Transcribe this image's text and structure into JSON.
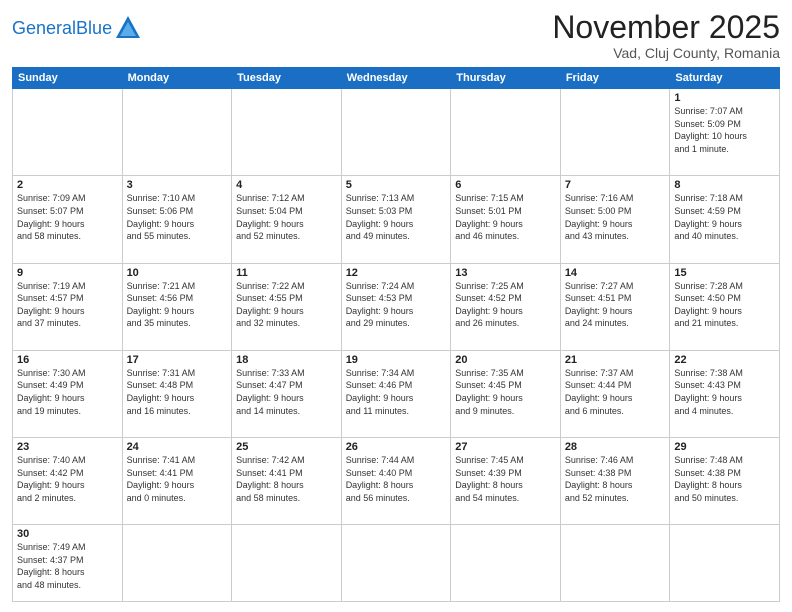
{
  "header": {
    "logo_general": "General",
    "logo_blue": "Blue",
    "month": "November 2025",
    "location": "Vad, Cluj County, Romania"
  },
  "weekdays": [
    "Sunday",
    "Monday",
    "Tuesday",
    "Wednesday",
    "Thursday",
    "Friday",
    "Saturday"
  ],
  "weeks": [
    [
      {
        "day": "",
        "info": ""
      },
      {
        "day": "",
        "info": ""
      },
      {
        "day": "",
        "info": ""
      },
      {
        "day": "",
        "info": ""
      },
      {
        "day": "",
        "info": ""
      },
      {
        "day": "",
        "info": ""
      },
      {
        "day": "1",
        "info": "Sunrise: 7:07 AM\nSunset: 5:09 PM\nDaylight: 10 hours\nand 1 minute."
      }
    ],
    [
      {
        "day": "2",
        "info": "Sunrise: 7:09 AM\nSunset: 5:07 PM\nDaylight: 9 hours\nand 58 minutes."
      },
      {
        "day": "3",
        "info": "Sunrise: 7:10 AM\nSunset: 5:06 PM\nDaylight: 9 hours\nand 55 minutes."
      },
      {
        "day": "4",
        "info": "Sunrise: 7:12 AM\nSunset: 5:04 PM\nDaylight: 9 hours\nand 52 minutes."
      },
      {
        "day": "5",
        "info": "Sunrise: 7:13 AM\nSunset: 5:03 PM\nDaylight: 9 hours\nand 49 minutes."
      },
      {
        "day": "6",
        "info": "Sunrise: 7:15 AM\nSunset: 5:01 PM\nDaylight: 9 hours\nand 46 minutes."
      },
      {
        "day": "7",
        "info": "Sunrise: 7:16 AM\nSunset: 5:00 PM\nDaylight: 9 hours\nand 43 minutes."
      },
      {
        "day": "8",
        "info": "Sunrise: 7:18 AM\nSunset: 4:59 PM\nDaylight: 9 hours\nand 40 minutes."
      }
    ],
    [
      {
        "day": "9",
        "info": "Sunrise: 7:19 AM\nSunset: 4:57 PM\nDaylight: 9 hours\nand 37 minutes."
      },
      {
        "day": "10",
        "info": "Sunrise: 7:21 AM\nSunset: 4:56 PM\nDaylight: 9 hours\nand 35 minutes."
      },
      {
        "day": "11",
        "info": "Sunrise: 7:22 AM\nSunset: 4:55 PM\nDaylight: 9 hours\nand 32 minutes."
      },
      {
        "day": "12",
        "info": "Sunrise: 7:24 AM\nSunset: 4:53 PM\nDaylight: 9 hours\nand 29 minutes."
      },
      {
        "day": "13",
        "info": "Sunrise: 7:25 AM\nSunset: 4:52 PM\nDaylight: 9 hours\nand 26 minutes."
      },
      {
        "day": "14",
        "info": "Sunrise: 7:27 AM\nSunset: 4:51 PM\nDaylight: 9 hours\nand 24 minutes."
      },
      {
        "day": "15",
        "info": "Sunrise: 7:28 AM\nSunset: 4:50 PM\nDaylight: 9 hours\nand 21 minutes."
      }
    ],
    [
      {
        "day": "16",
        "info": "Sunrise: 7:30 AM\nSunset: 4:49 PM\nDaylight: 9 hours\nand 19 minutes."
      },
      {
        "day": "17",
        "info": "Sunrise: 7:31 AM\nSunset: 4:48 PM\nDaylight: 9 hours\nand 16 minutes."
      },
      {
        "day": "18",
        "info": "Sunrise: 7:33 AM\nSunset: 4:47 PM\nDaylight: 9 hours\nand 14 minutes."
      },
      {
        "day": "19",
        "info": "Sunrise: 7:34 AM\nSunset: 4:46 PM\nDaylight: 9 hours\nand 11 minutes."
      },
      {
        "day": "20",
        "info": "Sunrise: 7:35 AM\nSunset: 4:45 PM\nDaylight: 9 hours\nand 9 minutes."
      },
      {
        "day": "21",
        "info": "Sunrise: 7:37 AM\nSunset: 4:44 PM\nDaylight: 9 hours\nand 6 minutes."
      },
      {
        "day": "22",
        "info": "Sunrise: 7:38 AM\nSunset: 4:43 PM\nDaylight: 9 hours\nand 4 minutes."
      }
    ],
    [
      {
        "day": "23",
        "info": "Sunrise: 7:40 AM\nSunset: 4:42 PM\nDaylight: 9 hours\nand 2 minutes."
      },
      {
        "day": "24",
        "info": "Sunrise: 7:41 AM\nSunset: 4:41 PM\nDaylight: 9 hours\nand 0 minutes."
      },
      {
        "day": "25",
        "info": "Sunrise: 7:42 AM\nSunset: 4:41 PM\nDaylight: 8 hours\nand 58 minutes."
      },
      {
        "day": "26",
        "info": "Sunrise: 7:44 AM\nSunset: 4:40 PM\nDaylight: 8 hours\nand 56 minutes."
      },
      {
        "day": "27",
        "info": "Sunrise: 7:45 AM\nSunset: 4:39 PM\nDaylight: 8 hours\nand 54 minutes."
      },
      {
        "day": "28",
        "info": "Sunrise: 7:46 AM\nSunset: 4:38 PM\nDaylight: 8 hours\nand 52 minutes."
      },
      {
        "day": "29",
        "info": "Sunrise: 7:48 AM\nSunset: 4:38 PM\nDaylight: 8 hours\nand 50 minutes."
      }
    ],
    [
      {
        "day": "30",
        "info": "Sunrise: 7:49 AM\nSunset: 4:37 PM\nDaylight: 8 hours\nand 48 minutes."
      },
      {
        "day": "",
        "info": ""
      },
      {
        "day": "",
        "info": ""
      },
      {
        "day": "",
        "info": ""
      },
      {
        "day": "",
        "info": ""
      },
      {
        "day": "",
        "info": ""
      },
      {
        "day": "",
        "info": ""
      }
    ]
  ]
}
